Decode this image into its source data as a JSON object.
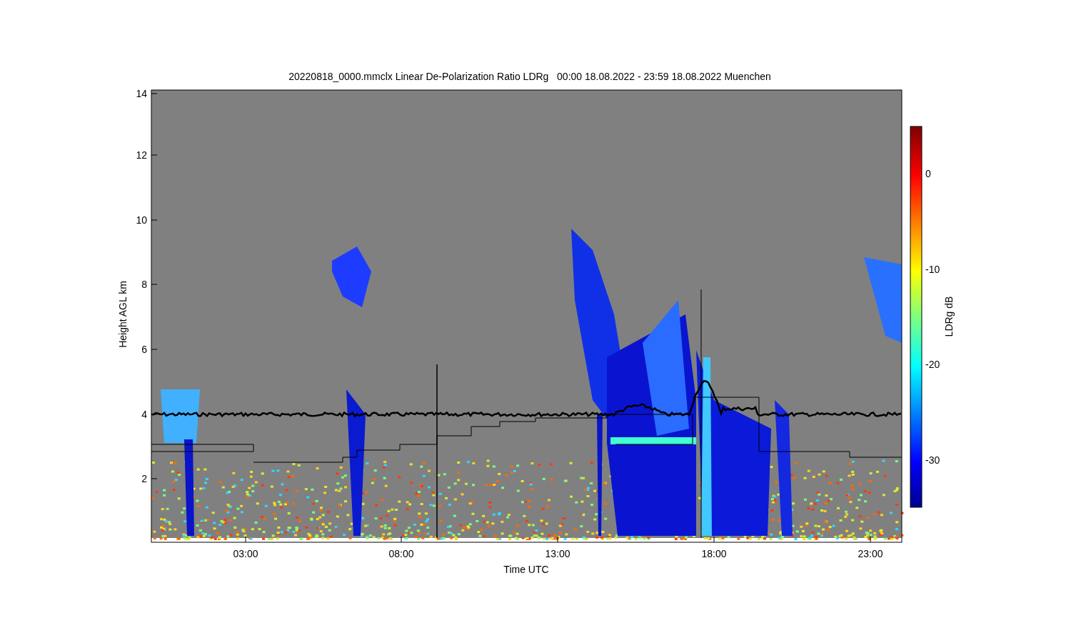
{
  "plot": {
    "title": "20220818_0000.mmclx Linear De-Polarization Ratio LDRg   00:00 18.08.2022 - 23:59 18.08.2022 Muenchen",
    "ylabel": "Height AGL km",
    "xlabel": "Time UTC",
    "yticks": [
      "14",
      "12",
      "10",
      "8",
      "6",
      "4",
      "2"
    ],
    "xticks": [
      "03:00",
      "08:00",
      "13:00",
      "18:00",
      "23:00"
    ]
  },
  "colorbar": {
    "label": "LDRg dB",
    "ticks": [
      "0",
      "-10",
      "-20",
      "-30"
    ]
  }
}
